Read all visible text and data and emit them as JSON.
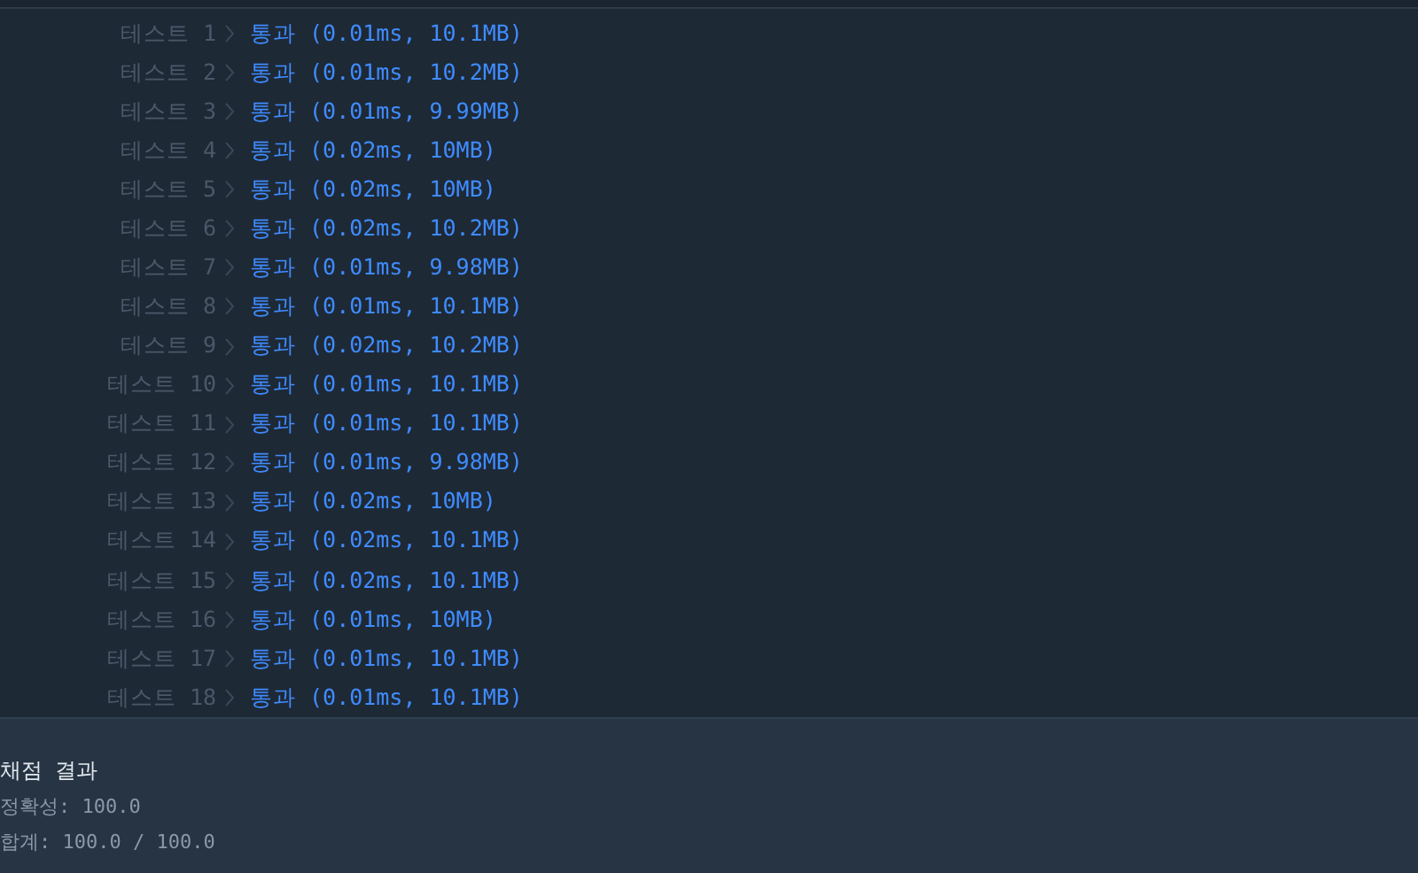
{
  "tests": [
    {
      "label": "테스트 1",
      "result": "통과 (0.01ms, 10.1MB)"
    },
    {
      "label": "테스트 2",
      "result": "통과 (0.01ms, 10.2MB)"
    },
    {
      "label": "테스트 3",
      "result": "통과 (0.01ms, 9.99MB)"
    },
    {
      "label": "테스트 4",
      "result": "통과 (0.02ms, 10MB)"
    },
    {
      "label": "테스트 5",
      "result": "통과 (0.02ms, 10MB)"
    },
    {
      "label": "테스트 6",
      "result": "통과 (0.02ms, 10.2MB)"
    },
    {
      "label": "테스트 7",
      "result": "통과 (0.01ms, 9.98MB)"
    },
    {
      "label": "테스트 8",
      "result": "통과 (0.01ms, 10.1MB)"
    },
    {
      "label": "테스트 9",
      "result": "통과 (0.02ms, 10.2MB)"
    },
    {
      "label": "테스트 10",
      "result": "통과 (0.01ms, 10.1MB)"
    },
    {
      "label": "테스트 11",
      "result": "통과 (0.01ms, 10.1MB)"
    },
    {
      "label": "테스트 12",
      "result": "통과 (0.01ms, 9.98MB)"
    },
    {
      "label": "테스트 13",
      "result": "통과 (0.02ms, 10MB)"
    },
    {
      "label": "테스트 14",
      "result": "통과 (0.02ms, 10.1MB)"
    },
    {
      "label": "테스트 15",
      "result": "통과 (0.02ms, 10.1MB)"
    },
    {
      "label": "테스트 16",
      "result": "통과 (0.01ms, 10MB)"
    },
    {
      "label": "테스트 17",
      "result": "통과 (0.01ms, 10.1MB)"
    },
    {
      "label": "테스트 18",
      "result": "통과 (0.01ms, 10.1MB)"
    }
  ],
  "summary": {
    "title": "채점 결과",
    "lines": [
      "정확성: 100.0",
      "합계: 100.0 / 100.0"
    ]
  }
}
